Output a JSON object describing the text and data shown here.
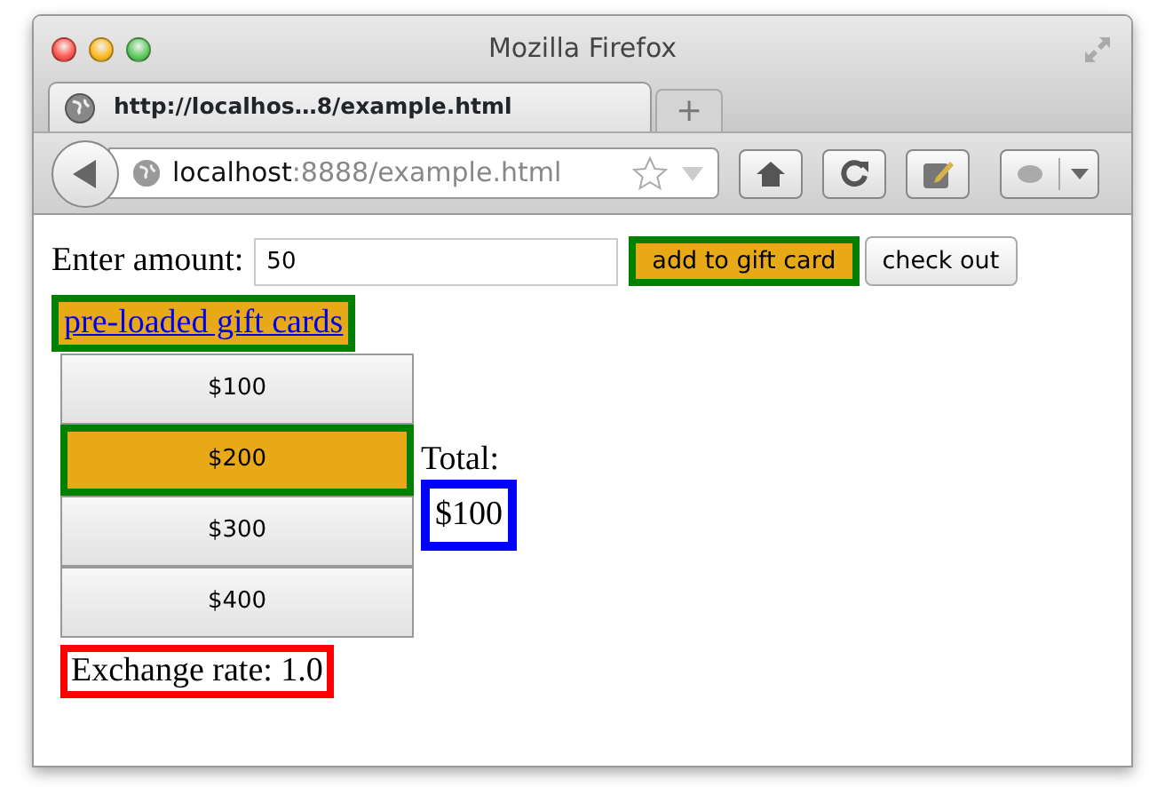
{
  "window": {
    "title": "Mozilla Firefox"
  },
  "tabs": [
    {
      "label": "http://localhos…8/example.html",
      "selected": true
    }
  ],
  "new_tab": "+",
  "address_bar": {
    "host": "localhost",
    "rest": ":8888/example.html"
  },
  "amount": {
    "label": "Enter amount:",
    "value": "50"
  },
  "add_button": {
    "label": "add to gift card",
    "highlighted": true
  },
  "checkout_button": {
    "label": "check out"
  },
  "preloaded_link": {
    "text": "pre-loaded gift cards",
    "highlighted": true
  },
  "gift_cards": [
    {
      "label": "$100",
      "selected": false
    },
    {
      "label": "$200",
      "selected": true
    },
    {
      "label": "$300",
      "selected": false
    },
    {
      "label": "$400",
      "selected": false
    }
  ],
  "total": {
    "label": "Total:",
    "value": "$100",
    "color": "#0000ff"
  },
  "exchange_rate": {
    "text": "Exchange rate: 1.0",
    "color": "#ff0000"
  }
}
